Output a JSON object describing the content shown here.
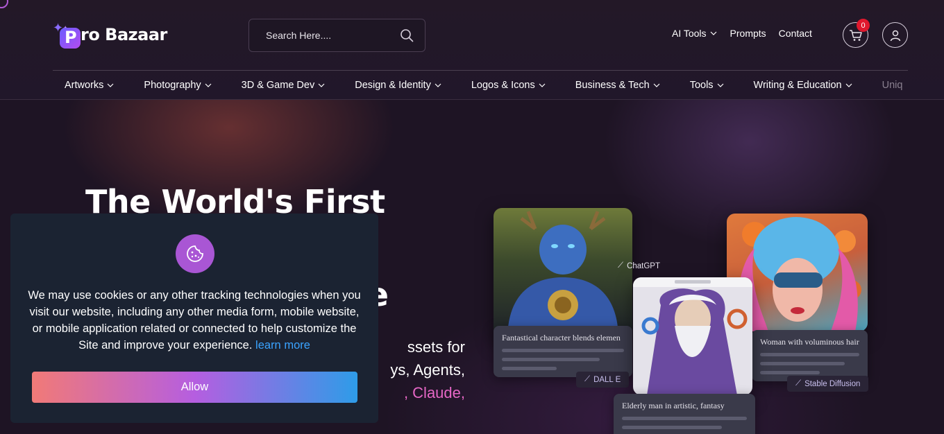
{
  "header": {
    "logo_text": "ro Bazaar",
    "logo_letter": "P",
    "search": {
      "placeholder": "Search Here...."
    },
    "topnav": [
      {
        "label": "AI Tools",
        "has_dropdown": true
      },
      {
        "label": "Prompts",
        "has_dropdown": false
      },
      {
        "label": "Contact",
        "has_dropdown": false
      }
    ],
    "cart_count": "0"
  },
  "categories": [
    "Artworks",
    "Photography",
    "3D & Game Dev",
    "Design & Identity",
    "Logos & Icons",
    "Business & Tech",
    "Tools",
    "Writing & Education",
    "Uniq"
  ],
  "hero": {
    "title_line1": "The World's First",
    "title_line2_visible": "e",
    "sub_line1": "ssets for",
    "sub_line2": "ys, Agents,",
    "sub_line3": ", Claude,"
  },
  "cards": {
    "card1": {
      "caption": "Fantastical character blends elemen",
      "tag": "DALL E"
    },
    "card2": {
      "caption": "Elderly man in artistic, fantasy",
      "tag": "ChatGPT"
    },
    "card3": {
      "caption": "Woman with voluminous hair",
      "tag": "Stable Diffusion"
    }
  },
  "cookie": {
    "text": "We may use cookies or any other tracking technologies when you visit our website, including any other media form, mobile website, or mobile application related or connected to help customize the Site and improve your experience.",
    "learn_more": "learn more",
    "allow_label": "Allow"
  },
  "colors": {
    "accent_purple": "#a956d4",
    "link_blue": "#3aa3ff",
    "badge_red": "#e0182d",
    "pink_text": "#e667c6"
  }
}
